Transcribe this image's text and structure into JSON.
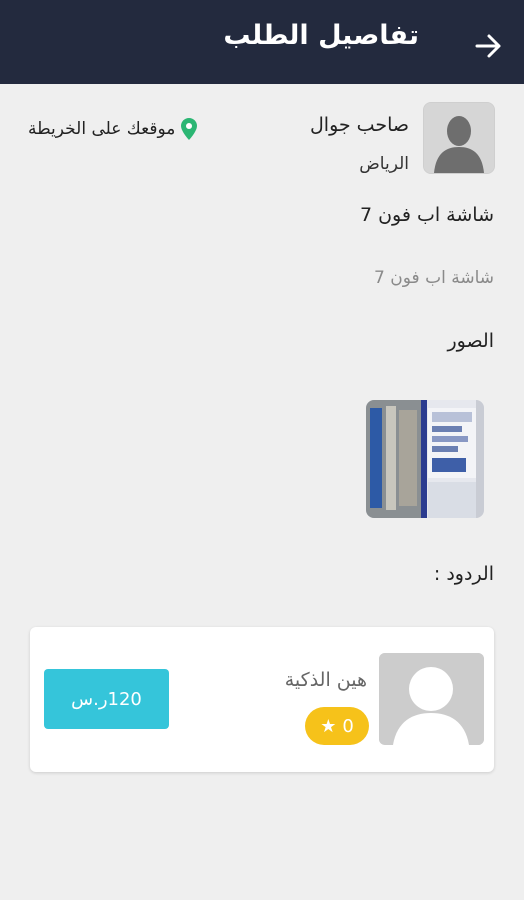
{
  "header": {
    "title": "تفاصيل الطلب",
    "background": "#232a3e"
  },
  "owner": {
    "name": "صاحب جوال",
    "city": "الرياض",
    "map_link": "موقعك على الخريطة",
    "pin_color": "#2bb673"
  },
  "request": {
    "title": "شاشة اب فون 7",
    "description": "شاشة اب فون 7"
  },
  "photos": {
    "label": "الصور"
  },
  "replies": {
    "label": "الردود :",
    "items": [
      {
        "name": "هين الذكية",
        "rating": "0",
        "price": "120ر.س"
      }
    ]
  },
  "colors": {
    "accent": "#35c5da",
    "rating": "#f6c21a"
  }
}
